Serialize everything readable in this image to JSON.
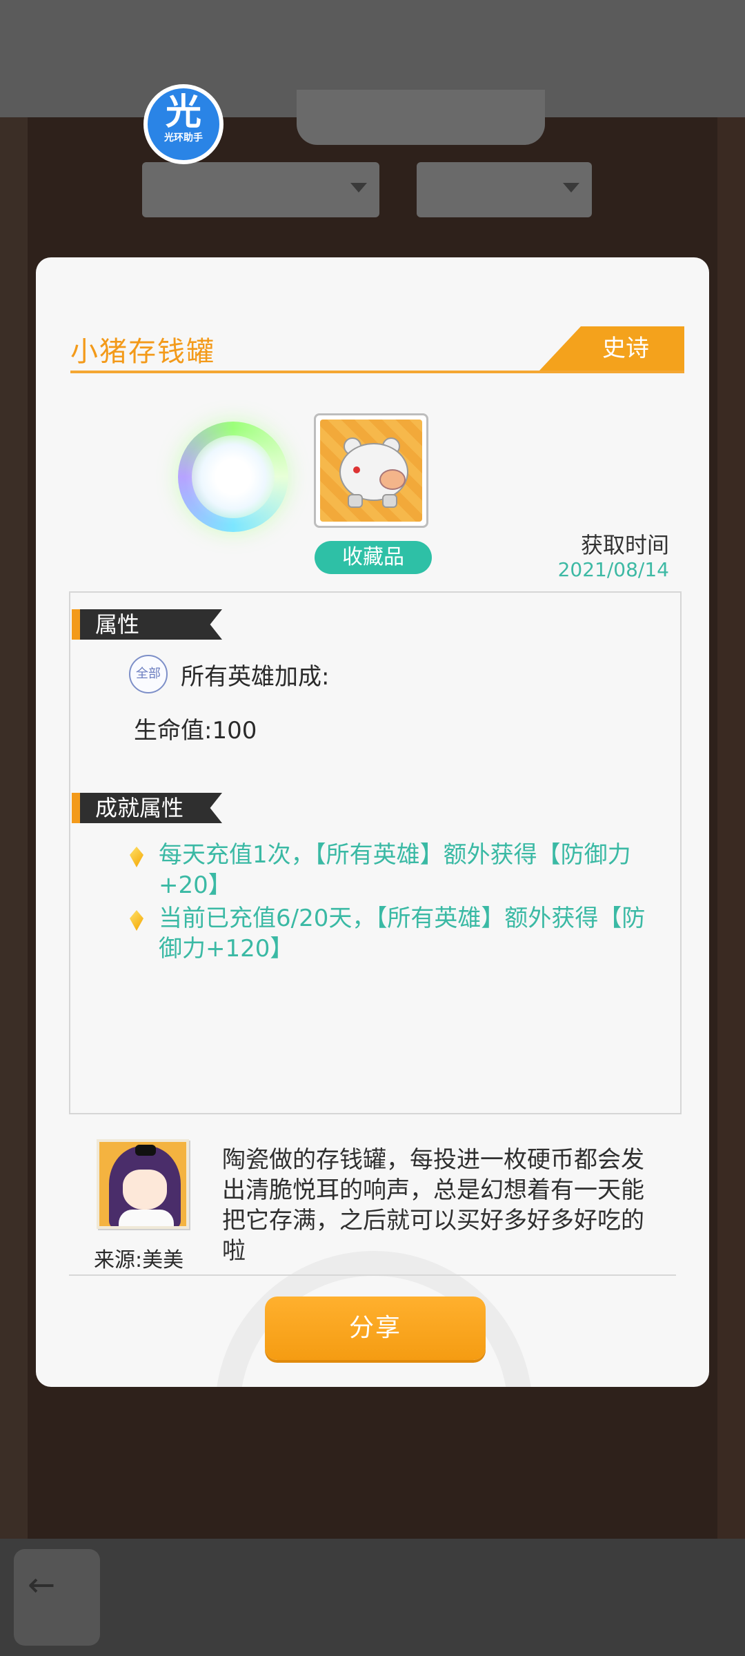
{
  "overlay_badge": {
    "big": "光",
    "small": "光环助手"
  },
  "item": {
    "name": "小猪存钱罐",
    "rarity": "史诗",
    "category": "收藏品",
    "obtain_label": "获取时间",
    "obtain_date": "2021/08/14"
  },
  "attributes": {
    "title": "属性",
    "all_badge": "全部",
    "bonus_label": "所有英雄加成:",
    "stats": [
      "生命值:100"
    ]
  },
  "achievements": {
    "title": "成就属性",
    "items": [
      "每天充值1次，【所有英雄】额外获得【防御力+20】",
      "当前已充值6/20天，【所有英雄】额外获得【防御力+120】"
    ]
  },
  "description": {
    "source": "来源:美美",
    "text": "陶瓷做的存钱罐，每投进一枚硬币都会发出清脆悦耳的响声，总是幻想着有一天能把它存满，之后就可以买好多好多好吃的啦"
  },
  "share_button": "分享",
  "colors": {
    "accent": "#f4a21c",
    "teal": "#2ec0a6"
  }
}
